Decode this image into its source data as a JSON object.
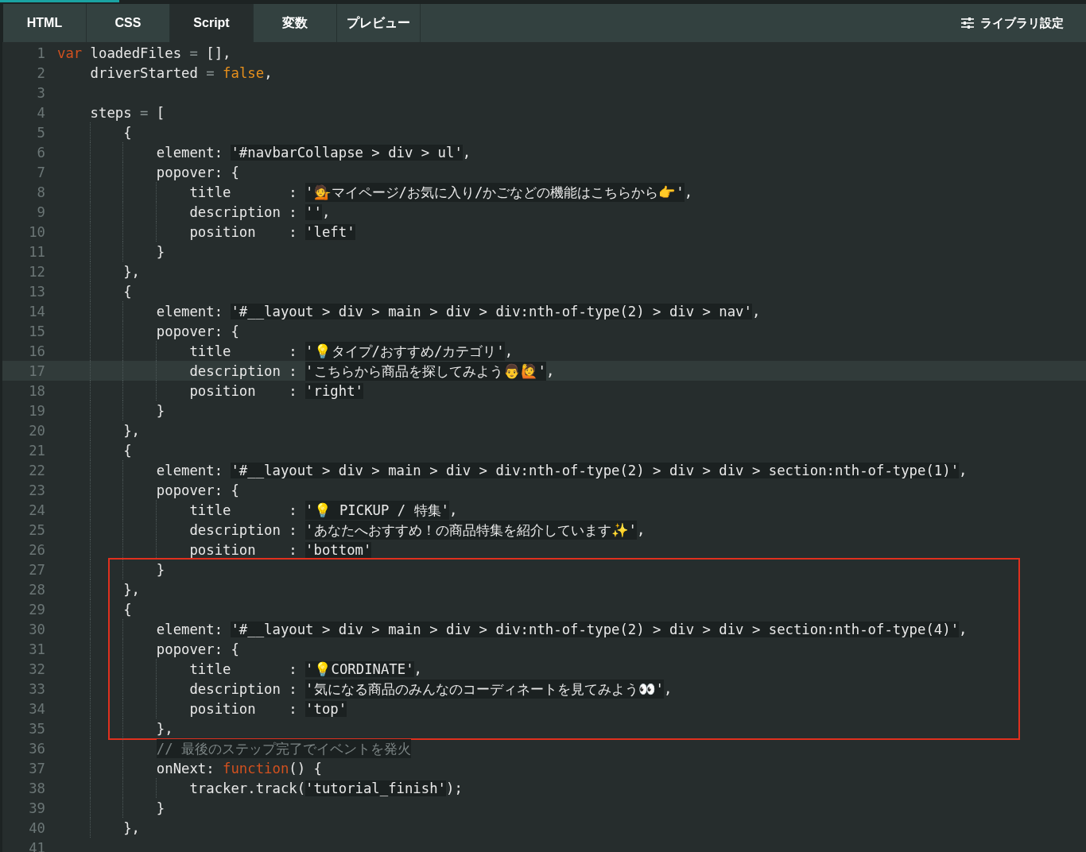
{
  "tabs": [
    {
      "label": "HTML",
      "selected": false
    },
    {
      "label": "CSS",
      "selected": false
    },
    {
      "label": "Script",
      "selected": true
    },
    {
      "label": "変数",
      "selected": false
    },
    {
      "label": "プレビュー",
      "selected": false
    }
  ],
  "settings_button": {
    "label": "ライブラリ設定"
  },
  "editor": {
    "blocks": [
      {
        "boxed": false,
        "lines": [
          {
            "number": "1",
            "current": false,
            "tokens": [
              {
                "kind": "keyword",
                "text": "var"
              },
              {
                "kind": "plain",
                "text": " loadedFiles "
              },
              {
                "kind": "operator",
                "text": "="
              },
              {
                "kind": "plain",
                "text": " [],"
              }
            ]
          },
          {
            "number": "2",
            "current": false,
            "tokens": [
              {
                "kind": "plain",
                "text": "    driverStarted "
              },
              {
                "kind": "operator",
                "text": "= "
              },
              {
                "kind": "literal",
                "text": "false"
              },
              {
                "kind": "plain",
                "text": ","
              }
            ]
          },
          {
            "number": "3",
            "current": false
          },
          {
            "number": "4",
            "current": false,
            "tokens": [
              {
                "kind": "plain",
                "text": "    steps "
              },
              {
                "kind": "operator",
                "text": "="
              },
              {
                "kind": "plain",
                "text": " ["
              }
            ]
          },
          {
            "number": "5",
            "current": false,
            "tokens": [
              {
                "kind": "plain",
                "text": "        {"
              }
            ]
          },
          {
            "number": "6",
            "current": false,
            "tokens": [
              {
                "kind": "plain",
                "text": "            element: "
              },
              {
                "kind": "string",
                "text": "'#navbarCollapse > div > ul'"
              },
              {
                "kind": "plain",
                "text": ","
              }
            ]
          },
          {
            "number": "7",
            "current": false,
            "tokens": [
              {
                "kind": "plain",
                "text": "            popover: {"
              }
            ]
          },
          {
            "number": "8",
            "current": false,
            "tokens": [
              {
                "kind": "plain",
                "text": "                title       : "
              },
              {
                "kind": "string",
                "text": "'💁マイページ/お気に入り/かごなどの機能はこちらから👉'"
              },
              {
                "kind": "plain",
                "text": ","
              }
            ]
          },
          {
            "number": "9",
            "current": false,
            "tokens": [
              {
                "kind": "plain",
                "text": "                description : "
              },
              {
                "kind": "string",
                "text": "''"
              },
              {
                "kind": "plain",
                "text": ","
              }
            ]
          },
          {
            "number": "10",
            "current": false,
            "tokens": [
              {
                "kind": "plain",
                "text": "                position    : "
              },
              {
                "kind": "string",
                "text": "'left'"
              }
            ]
          },
          {
            "number": "11",
            "current": false,
            "tokens": [
              {
                "kind": "plain",
                "text": "            }"
              }
            ]
          },
          {
            "number": "12",
            "current": false,
            "tokens": [
              {
                "kind": "plain",
                "text": "        },"
              }
            ]
          },
          {
            "number": "13",
            "current": false,
            "tokens": [
              {
                "kind": "plain",
                "text": "        {"
              }
            ]
          },
          {
            "number": "14",
            "current": false,
            "tokens": [
              {
                "kind": "plain",
                "text": "            element: "
              },
              {
                "kind": "string",
                "text": "'#__layout > div > main > div > div:nth-of-type(2) > div > nav'"
              },
              {
                "kind": "plain",
                "text": ","
              }
            ]
          },
          {
            "number": "15",
            "current": false,
            "tokens": [
              {
                "kind": "plain",
                "text": "            popover: {"
              }
            ]
          },
          {
            "number": "16",
            "current": false,
            "tokens": [
              {
                "kind": "plain",
                "text": "                title       : "
              },
              {
                "kind": "string",
                "text": "'💡タイプ/おすすめ/カテゴリ'"
              },
              {
                "kind": "plain",
                "text": ","
              }
            ]
          },
          {
            "number": "17",
            "current": true,
            "tokens": [
              {
                "kind": "plain",
                "text": "                description : "
              },
              {
                "kind": "string",
                "text": "'こちらから商品を探してみよう👨🙋'"
              },
              {
                "kind": "plain",
                "text": ","
              }
            ]
          },
          {
            "number": "18",
            "current": false,
            "tokens": [
              {
                "kind": "plain",
                "text": "                position    : "
              },
              {
                "kind": "string",
                "text": "'right'"
              }
            ]
          },
          {
            "number": "19",
            "current": false,
            "tokens": [
              {
                "kind": "plain",
                "text": "            }"
              }
            ]
          },
          {
            "number": "20",
            "current": false,
            "tokens": [
              {
                "kind": "plain",
                "text": "        },"
              }
            ]
          },
          {
            "number": "21",
            "current": false,
            "tokens": [
              {
                "kind": "plain",
                "text": "        {"
              }
            ]
          },
          {
            "number": "22",
            "current": false,
            "tokens": [
              {
                "kind": "plain",
                "text": "            element: "
              },
              {
                "kind": "string",
                "text": "'#__layout > div > main > div > div:nth-of-type(2) > div > div > section:nth-of-type(1)'"
              },
              {
                "kind": "plain",
                "text": ","
              }
            ]
          },
          {
            "number": "23",
            "current": false,
            "tokens": [
              {
                "kind": "plain",
                "text": "            popover: {"
              }
            ]
          },
          {
            "number": "24",
            "current": false,
            "tokens": [
              {
                "kind": "plain",
                "text": "                title       : "
              },
              {
                "kind": "string",
                "text": "'💡 PICKUP / 特集'"
              },
              {
                "kind": "plain",
                "text": ","
              }
            ]
          },
          {
            "number": "25",
            "current": false,
            "tokens": [
              {
                "kind": "plain",
                "text": "                description : "
              },
              {
                "kind": "string",
                "text": "'あなたへおすすめ！の商品特集を紹介しています✨'"
              },
              {
                "kind": "plain",
                "text": ","
              }
            ]
          },
          {
            "number": "26",
            "current": false,
            "tokens": [
              {
                "kind": "plain",
                "text": "                position    : "
              },
              {
                "kind": "string",
                "text": "'bottom'"
              }
            ]
          }
        ]
      },
      {
        "boxed": true,
        "lines": [
          {
            "number": "27",
            "current": false,
            "tokens": [
              {
                "kind": "plain",
                "text": "            }"
              }
            ]
          },
          {
            "number": "28",
            "current": false,
            "tokens": [
              {
                "kind": "plain",
                "text": "        },"
              }
            ]
          },
          {
            "number": "29",
            "current": false,
            "tokens": [
              {
                "kind": "plain",
                "text": "        {"
              }
            ]
          },
          {
            "number": "30",
            "current": false,
            "tokens": [
              {
                "kind": "plain",
                "text": "            element: "
              },
              {
                "kind": "string",
                "text": "'#__layout > div > main > div > div:nth-of-type(2) > div > div > section:nth-of-type(4)'"
              },
              {
                "kind": "plain",
                "text": ","
              }
            ]
          },
          {
            "number": "31",
            "current": false,
            "tokens": [
              {
                "kind": "plain",
                "text": "            popover: {"
              }
            ]
          },
          {
            "number": "32",
            "current": false,
            "tokens": [
              {
                "kind": "plain",
                "text": "                title       : "
              },
              {
                "kind": "string",
                "text": "'💡CORDINATE'"
              },
              {
                "kind": "plain",
                "text": ","
              }
            ]
          },
          {
            "number": "33",
            "current": false,
            "tokens": [
              {
                "kind": "plain",
                "text": "                description : "
              },
              {
                "kind": "string",
                "text": "'気になる商品のみんなのコーディネートを見てみよう👀'"
              },
              {
                "kind": "plain",
                "text": ","
              }
            ]
          },
          {
            "number": "34",
            "current": false,
            "tokens": [
              {
                "kind": "plain",
                "text": "                position    : "
              },
              {
                "kind": "string",
                "text": "'top'"
              }
            ]
          },
          {
            "number": "35",
            "current": false,
            "tokens": [
              {
                "kind": "plain",
                "text": "            },"
              }
            ]
          }
        ]
      },
      {
        "boxed": false,
        "lines": [
          {
            "number": "36",
            "current": false,
            "tokens": [
              {
                "kind": "comment",
                "text": "            // 最後のステップ完了でイベントを発火"
              }
            ]
          },
          {
            "number": "37",
            "current": false,
            "tokens": [
              {
                "kind": "plain",
                "text": "            onNext: "
              },
              {
                "kind": "keyword",
                "text": "function"
              },
              {
                "kind": "plain",
                "text": "() {"
              }
            ]
          },
          {
            "number": "38",
            "current": false,
            "tokens": [
              {
                "kind": "plain",
                "text": "                tracker.track("
              },
              {
                "kind": "string",
                "text": "'tutorial_finish'"
              },
              {
                "kind": "plain",
                "text": ");"
              }
            ]
          },
          {
            "number": "39",
            "current": false,
            "tokens": [
              {
                "kind": "plain",
                "text": "            }"
              }
            ]
          },
          {
            "number": "40",
            "current": false,
            "tokens": [
              {
                "kind": "plain",
                "text": "        },"
              }
            ]
          },
          {
            "number": "41",
            "current": false
          }
        ]
      }
    ]
  }
}
